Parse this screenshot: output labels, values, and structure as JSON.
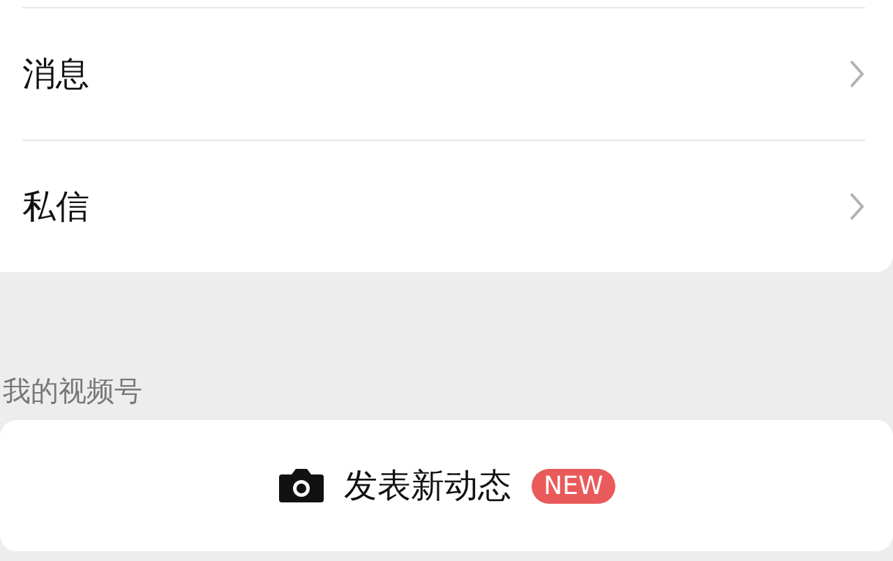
{
  "menu_items": [
    {
      "label": "消息"
    },
    {
      "label": "私信"
    }
  ],
  "section_title": "我的视频号",
  "post_button": {
    "label": "发表新动态",
    "badge": "NEW"
  }
}
